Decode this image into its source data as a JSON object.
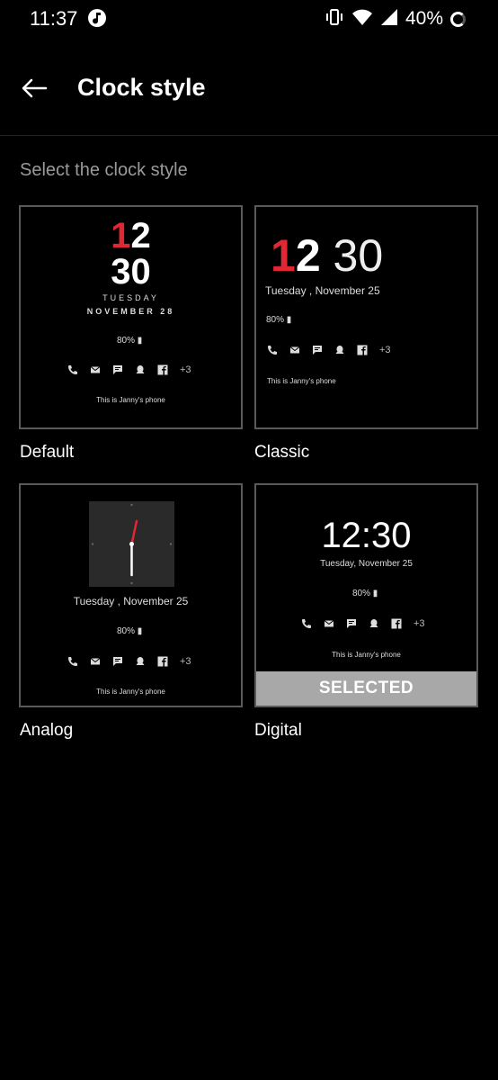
{
  "status": {
    "time": "11:37",
    "battery": "40%"
  },
  "header": {
    "title": "Clock style"
  },
  "section_label": "Select the clock style",
  "styles": [
    {
      "label": "Default",
      "hours_red": "1",
      "hours_white": "2",
      "minutes": "30",
      "day": "TUESDAY",
      "date": "NOVEMBER 28",
      "battery": "80%",
      "more": "+3",
      "phone_text": "This is Janny's phone"
    },
    {
      "label": "Classic",
      "hours_red": "1",
      "hours_white": "2",
      "minutes": "30",
      "date": "Tuesday , November  25",
      "battery": "80%",
      "more": "+3",
      "phone_text": "This is Janny's phone"
    },
    {
      "label": "Analog",
      "date": "Tuesday , November  25",
      "battery": "80%",
      "more": "+3",
      "phone_text": "This is Janny's phone"
    },
    {
      "label": "Digital",
      "time": "12:30",
      "date": "Tuesday, November  25",
      "battery": "80%",
      "more": "+3",
      "phone_text": "This is Janny's phone",
      "selected_text": "SELECTED"
    }
  ],
  "selected_style": "Digital",
  "colors": {
    "accent_red": "#e02835",
    "background": "#000000",
    "selected_bar": "#a8a8a8"
  }
}
